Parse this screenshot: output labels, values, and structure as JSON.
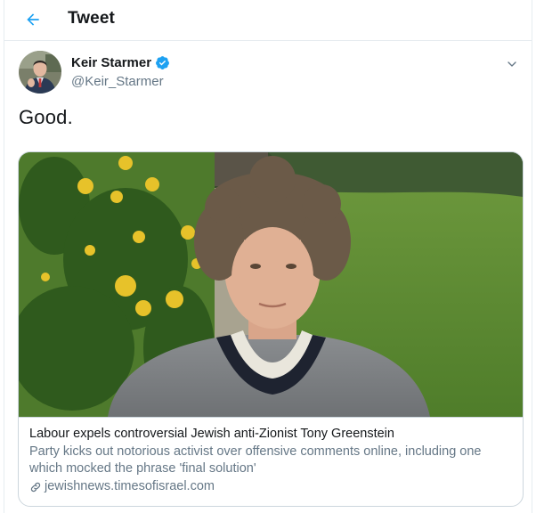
{
  "header": {
    "title": "Tweet",
    "back_icon": "arrow-left-icon"
  },
  "author": {
    "name": "Keir Starmer",
    "handle": "@Keir_Starmer",
    "verified": true,
    "verified_icon": "verified-badge-icon"
  },
  "tweet": {
    "text": "Good."
  },
  "card": {
    "title": "Labour expels controversial Jewish anti-Zionist Tony Greenstein",
    "description": "Party kicks out notorious activist over offensive comments online, including one which mocked the phrase 'final solution'",
    "domain": "jewishnews.timesofisrael.com",
    "link_icon": "link-icon"
  },
  "colors": {
    "accent": "#1da1f2",
    "text_primary": "#14171a",
    "text_secondary": "#657786",
    "border": "#ccd6dd"
  }
}
